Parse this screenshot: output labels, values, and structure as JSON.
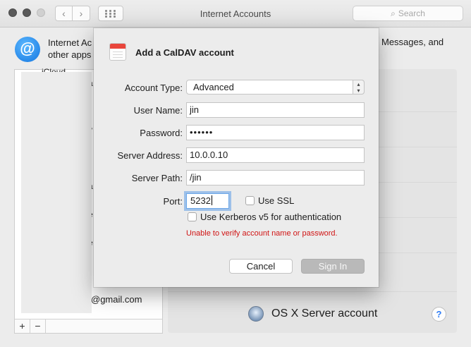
{
  "window": {
    "title": "Internet Accounts",
    "search_placeholder": "Search"
  },
  "background": {
    "description_line1": "Internet Ac",
    "description_line2": "other apps",
    "description_right": "Messages, and",
    "account_fragments": [
      "iCloud",
      "a",
      "y",
      "a",
      "e",
      "e"
    ],
    "gmail_fragment": "@gmail.com",
    "add_label": "+",
    "remove_label": "−",
    "osx_server_label": "OS X Server account",
    "help_label": "?"
  },
  "sheet": {
    "title": "Add a CalDAV account",
    "account_type": {
      "label": "Account Type:",
      "value": "Advanced"
    },
    "user_name": {
      "label": "User Name:",
      "value": "jin"
    },
    "password": {
      "label": "Password:",
      "value": "••••••"
    },
    "server_address": {
      "label": "Server Address:",
      "value": "10.0.0.10"
    },
    "server_path": {
      "label": "Server Path:",
      "value": "/jin"
    },
    "port": {
      "label": "Port:",
      "value": "5232"
    },
    "use_ssl": {
      "label": "Use SSL",
      "checked": false
    },
    "use_kerberos": {
      "label": "Use Kerberos v5 for authentication",
      "checked": false
    },
    "error": "Unable to verify account name or password.",
    "error_color": "#d01414",
    "cancel_label": "Cancel",
    "signin_label": "Sign In"
  }
}
